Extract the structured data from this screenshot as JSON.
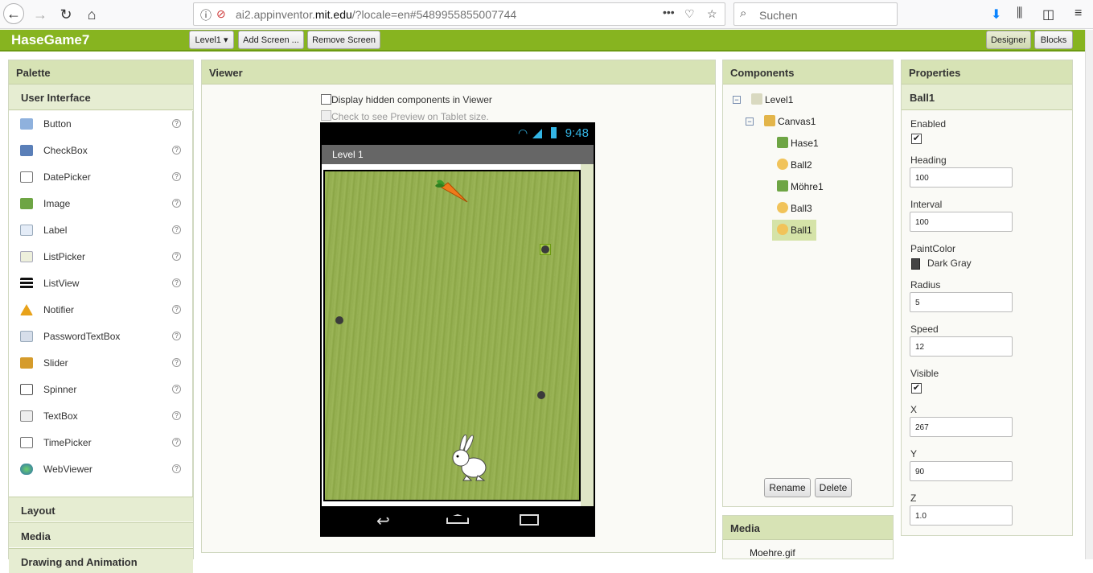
{
  "browser": {
    "url_prefix": "ai2.appinventor.",
    "url_domain": "mit.edu",
    "url_suffix": "/?locale=en#5489955855007744",
    "search_placeholder": "Suchen",
    "menu_dots": "•••"
  },
  "header": {
    "app_name": "HaseGame7",
    "screen_select": "Level1 ▾",
    "add_screen": "Add Screen ...",
    "remove_screen": "Remove Screen",
    "designer": "Designer",
    "blocks": "Blocks"
  },
  "palette": {
    "title": "Palette",
    "section": "User Interface",
    "items": [
      {
        "label": "Button",
        "color": "#8fb1dd"
      },
      {
        "label": "CheckBox",
        "color": "#5a7fb8"
      },
      {
        "label": "DatePicker",
        "color": "#777777"
      },
      {
        "label": "Image",
        "color": "#6ea544"
      },
      {
        "label": "Label",
        "color": "#c8d8ee"
      },
      {
        "label": "ListPicker",
        "color": "#c9cfa0"
      },
      {
        "label": "ListView",
        "color": "#111111"
      },
      {
        "label": "Notifier",
        "color": "#e8a21a"
      },
      {
        "label": "PasswordTextBox",
        "color": "#b7c4d8"
      },
      {
        "label": "Slider",
        "color": "#d59b2b"
      },
      {
        "label": "Spinner",
        "color": "#555555"
      },
      {
        "label": "TextBox",
        "color": "#a9a9a9"
      },
      {
        "label": "TimePicker",
        "color": "#888888"
      },
      {
        "label": "WebViewer",
        "color": "#3f7fbf"
      }
    ],
    "help_glyph": "?",
    "sections": [
      "Layout",
      "Media",
      "Drawing and Animation"
    ]
  },
  "viewer": {
    "title": "Viewer",
    "hidden_label": "Display hidden components in Viewer",
    "tablet_label": "Check to see Preview on Tablet size.",
    "time": "9:48",
    "screen_title": "Level 1"
  },
  "components": {
    "title": "Components",
    "tree": [
      {
        "label": "Level1",
        "color": "#d9d9c0"
      },
      {
        "label": "Canvas1",
        "color": "#e3b54a"
      },
      {
        "label": "Hase1",
        "color": "#6ea544"
      },
      {
        "label": "Ball2",
        "color": "#f1c35a"
      },
      {
        "label": "Möhre1",
        "color": "#6ea544"
      },
      {
        "label": "Ball3",
        "color": "#f1c35a"
      },
      {
        "label": "Ball1",
        "color": "#f1c35a"
      }
    ],
    "rename": "Rename",
    "delete": "Delete",
    "media_title": "Media",
    "media_file": "Moehre.gif",
    "tree_toggle": "−"
  },
  "properties": {
    "title": "Properties",
    "component": "Ball1",
    "enabled_label": "Enabled",
    "heading_label": "Heading",
    "heading": "100",
    "interval_label": "Interval",
    "interval": "100",
    "paintcolor_label": "PaintColor",
    "paintcolor": "Dark Gray",
    "radius_label": "Radius",
    "radius": "5",
    "speed_label": "Speed",
    "speed": "12",
    "visible_label": "Visible",
    "x_label": "X",
    "x": "267",
    "y_label": "Y",
    "y": "90",
    "z_label": "Z",
    "z": "1.0",
    "check_glyph": "✔"
  }
}
